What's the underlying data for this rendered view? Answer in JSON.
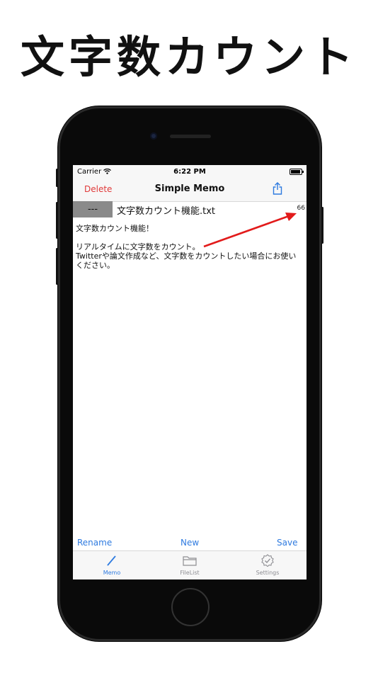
{
  "headline": "文字数カウント",
  "status_bar": {
    "carrier": "Carrier",
    "time": "6:22 PM",
    "battery_level_percent": 90
  },
  "nav": {
    "left_button": "Delete",
    "title": "Simple Memo",
    "right_icon": "share-icon"
  },
  "file_bar": {
    "button_label": "---",
    "filename": "文字数カウント機能.txt",
    "char_count": "66"
  },
  "memo_lines": [
    "文字数カウント機能！",
    "",
    "リアルタイムに文字数をカウント。",
    "Twitterや論文作成など、文字数をカウントしたい場合にお使い",
    "ください。"
  ],
  "bottom_actions": {
    "rename": "Rename",
    "new": "New",
    "save": "Save"
  },
  "tabs": [
    {
      "label": "Memo",
      "icon": "pencil-icon",
      "active": true
    },
    {
      "label": "FileList",
      "icon": "folder-icon",
      "active": false
    },
    {
      "label": "Settings",
      "icon": "gear-check-icon",
      "active": false
    }
  ],
  "colors": {
    "accent": "#2f7be0",
    "delete": "#e03a3a",
    "arrow": "#e21b1b"
  }
}
